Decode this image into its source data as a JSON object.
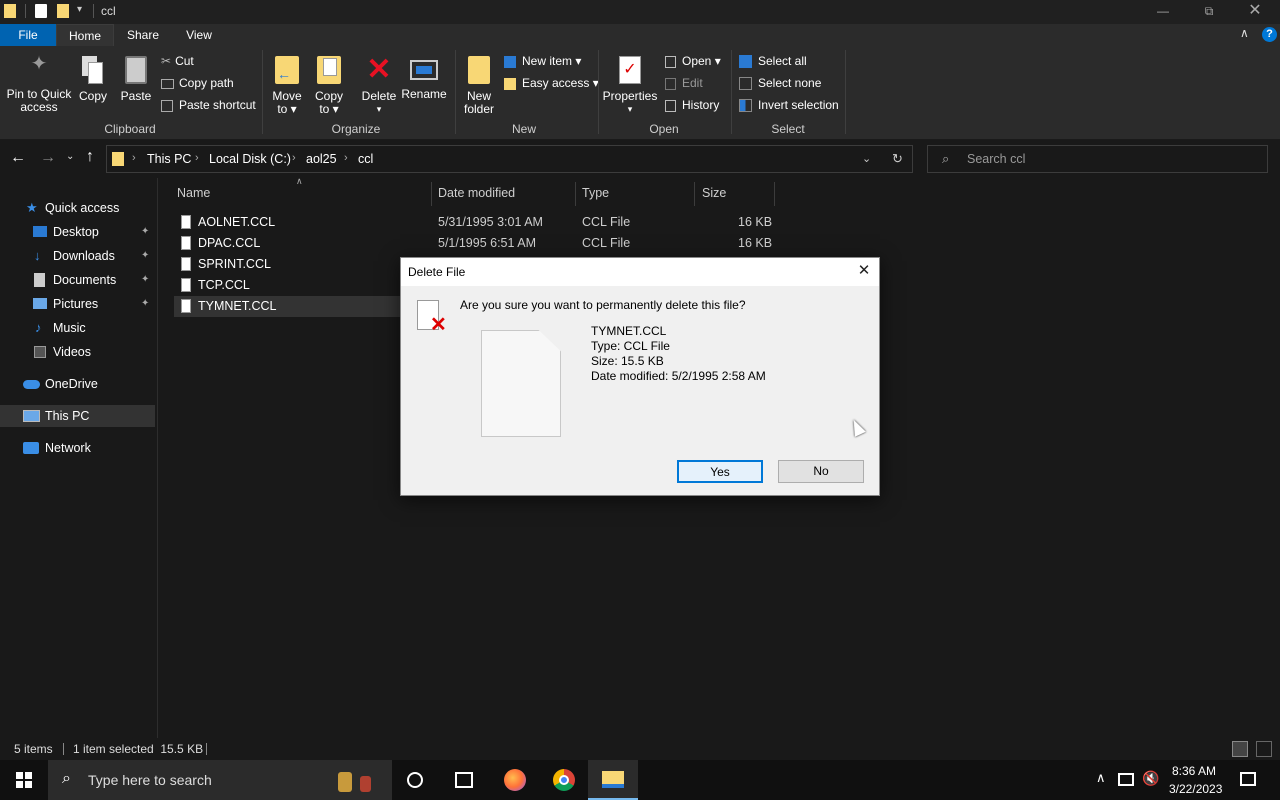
{
  "window": {
    "title": "ccl"
  },
  "tabs": [
    "File",
    "Home",
    "Share",
    "View"
  ],
  "ribbon": {
    "clipboard": {
      "pin": "Pin to Quick access",
      "pin1": "Pin to Quick",
      "pin2": "access",
      "copy": "Copy",
      "paste": "Paste",
      "cut": "Cut",
      "copy_path": "Copy path",
      "paste_shortcut": "Paste shortcut",
      "label": "Clipboard"
    },
    "organize": {
      "move1": "Move",
      "move2": "to",
      "copy1": "Copy",
      "copy2": "to",
      "delete": "Delete",
      "rename": "Rename",
      "label": "Organize"
    },
    "new": {
      "folder1": "New",
      "folder2": "folder",
      "new_item": "New item",
      "easy_access": "Easy access",
      "label": "New"
    },
    "open": {
      "properties": "Properties",
      "open": "Open",
      "edit": "Edit",
      "history": "History",
      "label": "Open"
    },
    "select": {
      "select_all": "Select all",
      "select_none": "Select none",
      "invert": "Invert selection",
      "label": "Select"
    }
  },
  "address": {
    "crumbs": [
      "This PC",
      "Local Disk (C:)",
      "aol25",
      "ccl"
    ],
    "search_placeholder": "Search ccl"
  },
  "sidebar": {
    "quick_access": "Quick access",
    "items": [
      "Desktop",
      "Downloads",
      "Documents",
      "Pictures",
      "Music",
      "Videos"
    ],
    "onedrive": "OneDrive",
    "thispc": "This PC",
    "network": "Network"
  },
  "columns": {
    "name": "Name",
    "date": "Date modified",
    "type": "Type",
    "size": "Size"
  },
  "files": [
    {
      "name": "AOLNET.CCL",
      "date": "5/31/1995 3:01 AM",
      "type": "CCL File",
      "size": "16 KB"
    },
    {
      "name": "DPAC.CCL",
      "date": "5/1/1995 6:51 AM",
      "type": "CCL File",
      "size": "16 KB"
    },
    {
      "name": "SPRINT.CCL",
      "date": "",
      "type": "",
      "size": ""
    },
    {
      "name": "TCP.CCL",
      "date": "",
      "type": "",
      "size": ""
    },
    {
      "name": "TYMNET.CCL",
      "date": "",
      "type": "",
      "size": ""
    }
  ],
  "status": {
    "items": "5 items",
    "selected": "1 item selected  15.5 KB"
  },
  "dialog": {
    "title": "Delete File",
    "question": "Are you sure you want to permanently delete this file?",
    "file_name": "TYMNET.CCL",
    "file_type": "Type: CCL File",
    "file_size": "Size: 15.5 KB",
    "file_date": "Date modified: 5/2/1995 2:58 AM",
    "yes": "Yes",
    "no": "No"
  },
  "taskbar": {
    "search_placeholder": "Type here to search",
    "time": "8:36 AM",
    "date": "3/22/2023"
  },
  "colors": {
    "accent": "#0078d7",
    "selection": "#333333",
    "delete_red": "#e81123",
    "folder": "#f8d775"
  }
}
